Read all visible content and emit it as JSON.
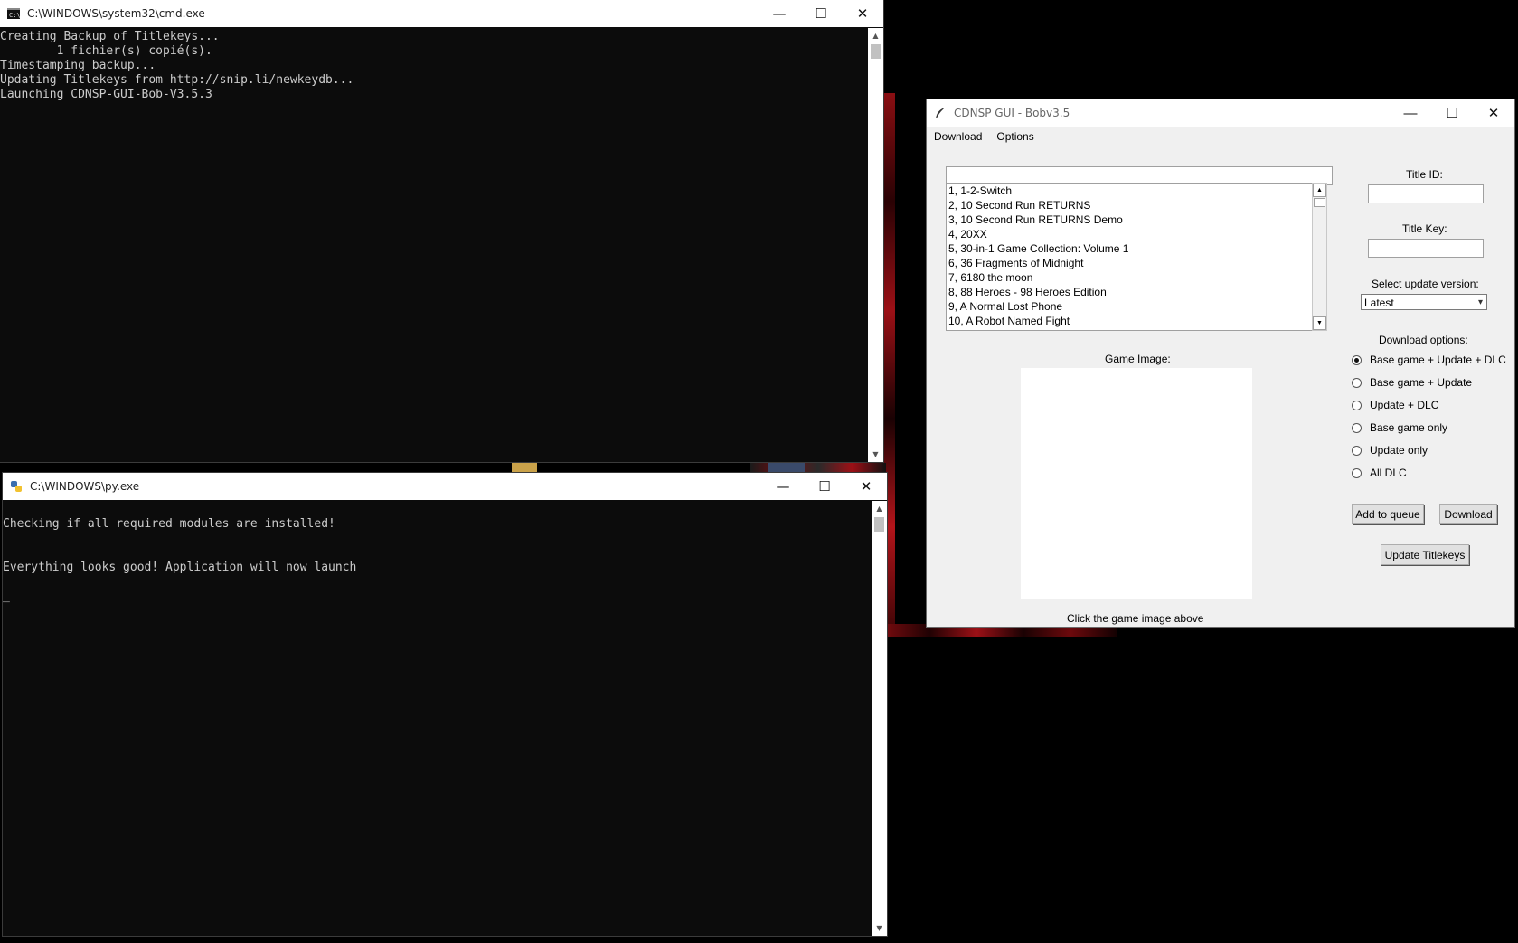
{
  "cmd_window": {
    "title": "C:\\WINDOWS\\system32\\cmd.exe",
    "output": "Creating Backup of Titlekeys...\n        1 fichier(s) copié(s).\nTimestamping backup...\nUpdating Titlekeys from http://snip.li/newkeydb...\nLaunching CDNSP-GUI-Bob-V3.5.3"
  },
  "py_window": {
    "title": "C:\\WINDOWS\\py.exe",
    "output": "\nChecking if all required modules are installed!\n\n\nEverything looks good! Application will now launch\n\n_"
  },
  "window_controls": {
    "minimize": "—",
    "maximize": "☐",
    "close": "✕"
  },
  "gui": {
    "title": "CDNSP GUI - Bobv3.5",
    "menu": [
      "Download",
      "Options"
    ],
    "search_value": "",
    "games": [
      "1, 1-2-Switch",
      "2, 10 Second Run RETURNS",
      "3, 10 Second Run RETURNS Demo",
      "4, 20XX",
      "5, 30-in-1 Game Collection: Volume 1",
      "6, 36 Fragments of Midnight",
      "7, 6180 the moon",
      "8, 88 Heroes - 98 Heroes Edition",
      "9, A Normal Lost Phone",
      "10, A Robot Named Fight"
    ],
    "game_image_label": "Game Image:",
    "game_image_hint": "Click the game image above",
    "title_id_label": "Title ID:",
    "title_id_value": "",
    "title_key_label": "Title Key:",
    "title_key_value": "",
    "update_version_label": "Select update version:",
    "update_version_value": "Latest",
    "download_options_label": "Download options:",
    "download_options": [
      {
        "label": "Base game + Update + DLC",
        "selected": true
      },
      {
        "label": "Base game + Update",
        "selected": false
      },
      {
        "label": "Update + DLC",
        "selected": false
      },
      {
        "label": "Base game only",
        "selected": false
      },
      {
        "label": "Update only",
        "selected": false
      },
      {
        "label": "All DLC",
        "selected": false
      }
    ],
    "add_to_queue_label": "Add to queue",
    "download_label": "Download",
    "update_titlekeys_label": "Update Titlekeys"
  }
}
